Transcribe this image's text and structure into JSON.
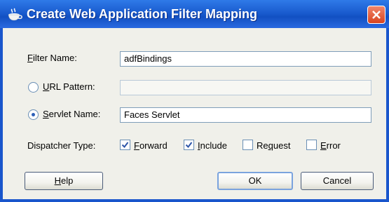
{
  "dialog": {
    "title": "Create Web Application Filter Mapping",
    "icon": "coffee-cup-icon",
    "close_icon": "close-icon",
    "accent": "#1a5ccf"
  },
  "form": {
    "filter_name": {
      "label_mnemonic": "F",
      "label_rest": "ilter Name:",
      "value": "adfBindings"
    },
    "url_pattern": {
      "label_mnemonic": "U",
      "label_rest": "RL Pattern:",
      "value": "",
      "selected": false
    },
    "servlet_name": {
      "label_mnemonic": "S",
      "label_rest": "ervlet Name:",
      "value": "Faces Servlet",
      "selected": true
    },
    "dispatcher_type": {
      "label": "Dispatcher Type:",
      "options": [
        {
          "mnemonic": "F",
          "rest": "orward",
          "checked": true
        },
        {
          "mnemonic": "I",
          "rest": "nclude",
          "checked": true
        },
        {
          "pre": "Re",
          "mnemonic": "q",
          "rest": "uest",
          "checked": false
        },
        {
          "mnemonic": "E",
          "rest": "rror",
          "checked": false
        }
      ]
    }
  },
  "buttons": {
    "help": {
      "mnemonic": "H",
      "rest": "elp"
    },
    "ok": {
      "label": "OK"
    },
    "cancel": {
      "label": "Cancel"
    }
  }
}
